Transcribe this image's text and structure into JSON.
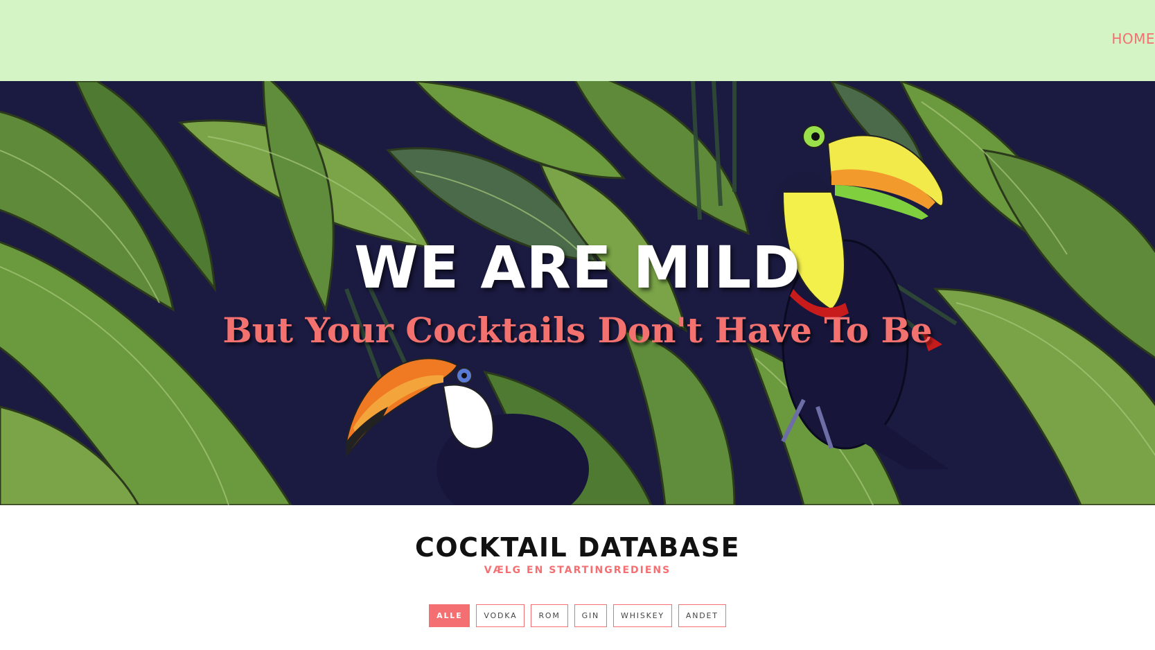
{
  "nav": {
    "home_label": "HOME"
  },
  "hero": {
    "title": "WE ARE MILD",
    "subtitle": "But Your Cocktails Don't Have To Be"
  },
  "database": {
    "title": "COCKTAIL DATABASE",
    "subtitle": "VÆLG EN STARTINGREDIENS"
  },
  "filters": {
    "items": [
      {
        "label": "ALLE",
        "active": true
      },
      {
        "label": "VODKA",
        "active": false
      },
      {
        "label": "ROM",
        "active": false
      },
      {
        "label": "GIN",
        "active": false
      },
      {
        "label": "WHISKEY",
        "active": false
      },
      {
        "label": "ANDET",
        "active": false
      }
    ]
  },
  "colors": {
    "topbar_bg": "#d4f4c6",
    "accent": "#f36f72",
    "hero_bg": "#1b1a40",
    "leaf_green": "#5e8a3a"
  }
}
